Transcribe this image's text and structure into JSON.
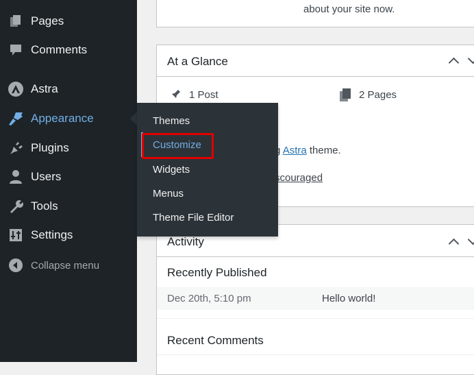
{
  "sidebar": {
    "items": [
      {
        "label": "Pages",
        "icon": "pages-icon"
      },
      {
        "label": "Comments",
        "icon": "comments-icon"
      },
      {
        "label": "Astra",
        "icon": "astra-icon"
      },
      {
        "label": "Appearance",
        "icon": "paintbrush-icon",
        "current": true
      },
      {
        "label": "Plugins",
        "icon": "plug-icon"
      },
      {
        "label": "Users",
        "icon": "user-icon"
      },
      {
        "label": "Tools",
        "icon": "wrench-icon"
      },
      {
        "label": "Settings",
        "icon": "settings-sliders-icon"
      },
      {
        "label": "Collapse menu",
        "icon": "collapse-arrow-icon"
      }
    ]
  },
  "flyout": {
    "items": [
      "Themes",
      "Customize",
      "Widgets",
      "Menus",
      "Theme File Editor"
    ],
    "highlighted": "Customize",
    "highlight_color": "#e00000"
  },
  "welcome": {
    "text": "about your site now."
  },
  "glance": {
    "title": "At a Glance",
    "posts": "1 Post",
    "pages": "2 Pages",
    "theme_prefix": "g ",
    "theme_link": "Astra",
    "theme_suffix": " theme.",
    "search_fragment": "scouraged"
  },
  "activity": {
    "title": "Activity",
    "recently_published": "Recently Published",
    "rows": [
      {
        "date": "Dec 20th, 5:10 pm",
        "title": "Hello world!"
      }
    ],
    "recent_comments": "Recent Comments"
  },
  "colors": {
    "sidebar": "#1d2327",
    "flyout": "#2c3338",
    "accent": "#72aee6",
    "link": "#2271b1"
  }
}
